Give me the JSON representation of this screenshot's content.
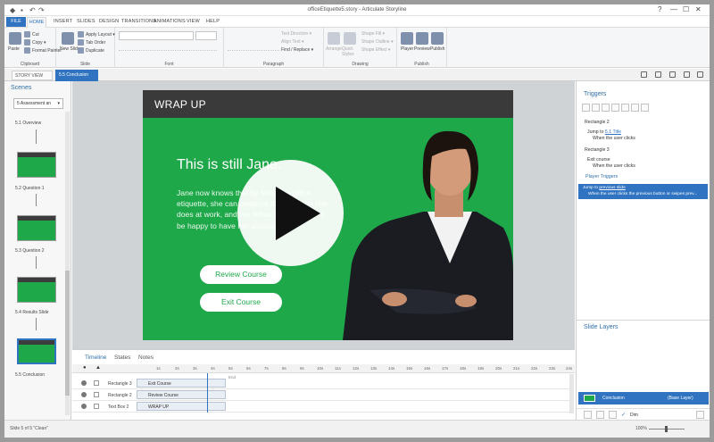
{
  "window": {
    "title": "officeEtiquette5.story - Articulate Storyline",
    "controls": [
      "?",
      "—",
      "☐",
      "✕"
    ]
  },
  "menu": {
    "file": "FILE",
    "home": "HOME",
    "tabs": [
      "INSERT",
      "SLIDES",
      "DESIGN",
      "TRANSITIONS",
      "ANIMATIONS",
      "VIEW",
      "HELP"
    ]
  },
  "ribbon": {
    "clipboard": {
      "paste": "Paste",
      "cut": "Cut",
      "copy": "Copy ▾",
      "format_painter": "Format Painter",
      "label": "Clipboard"
    },
    "slide": {
      "new_slide": "New Slide",
      "apply_layout": "Apply Layout ▾",
      "tab_order": "Tab Order",
      "duplicate": "Duplicate",
      "label": "Slide"
    },
    "font": {
      "label": "Font"
    },
    "paragraph": {
      "text_direction": "Text Direction ▾",
      "align_text": "Align Text ▾",
      "find_replace": "Find / Replace ▾",
      "label": "Paragraph"
    },
    "drawing": {
      "arrange": "Arrange",
      "quick_styles": "Quick Styles",
      "shape_fill": "Shape Fill ▾",
      "shape_outline": "Shape Outline ▾",
      "shape_effect": "Shape Effect ▾",
      "label": "Drawing"
    },
    "publish": {
      "player": "Player",
      "preview": "Preview",
      "publish": "Publish",
      "label": "Publish"
    }
  },
  "doc_tabs": {
    "story_view": "STORY VIEW",
    "active": "5.5 Conclusion"
  },
  "scenes": {
    "title": "Scenes",
    "selected": "5 Assessment an",
    "items": [
      "5.1 Overview",
      "5.2 Question 1",
      "5.3 Question 2",
      "5.4 Results Slide",
      "5.5 Conclusion"
    ]
  },
  "slide": {
    "header": "WRAP UP",
    "title": "This is still Jane.",
    "body": "Jane now knows that by following office etiquette, she can continue the good job she does at work, and her fellow employees will be happy to have her around.",
    "review_button": "Review Course",
    "exit_button": "Exit Course"
  },
  "timeline": {
    "tabs": [
      "Timeline",
      "States",
      "Notes"
    ],
    "ticks": [
      "1s",
      "2s",
      "3s",
      "4s",
      "5s",
      "6s",
      "7s",
      "8s",
      "9s",
      "10s",
      "11s",
      "12s",
      "13s",
      "14s",
      "15s",
      "16s",
      "17s",
      "18s",
      "19s",
      "20s",
      "21s",
      "22s",
      "23s",
      "24s"
    ],
    "end_label": "End",
    "rows": [
      {
        "name": "Rectangle 3",
        "bar": "Exit Course"
      },
      {
        "name": "Rectangle 2",
        "bar": "Review Course"
      },
      {
        "name": "Text Box 2",
        "bar": "WRAP UP"
      }
    ]
  },
  "triggers": {
    "title": "Triggers",
    "items": [
      {
        "object": "Rectangle 2",
        "action": "Jump to",
        "target": "5.1 Title",
        "when": "When the user clicks"
      },
      {
        "object": "Rectangle 3",
        "action": "Exit course",
        "target": "",
        "when": "When the user clicks"
      }
    ],
    "player_title": "Player Triggers",
    "player_action": "Jump to",
    "player_target": "previous slide",
    "player_when": "When the user clicks the previous button or swipes prev..."
  },
  "slide_layers": {
    "title": "Slide Layers",
    "layer_name": "Conclusion",
    "layer_kind": "(Base Layer)",
    "dim": "Dim"
  },
  "status": {
    "text": "Slide 5 of 5   \"Clean\"",
    "zoom": "100%"
  },
  "colors": {
    "accent": "#2f73c1",
    "slide_green": "#1fa84a",
    "slide_header": "#3a3a3a"
  }
}
